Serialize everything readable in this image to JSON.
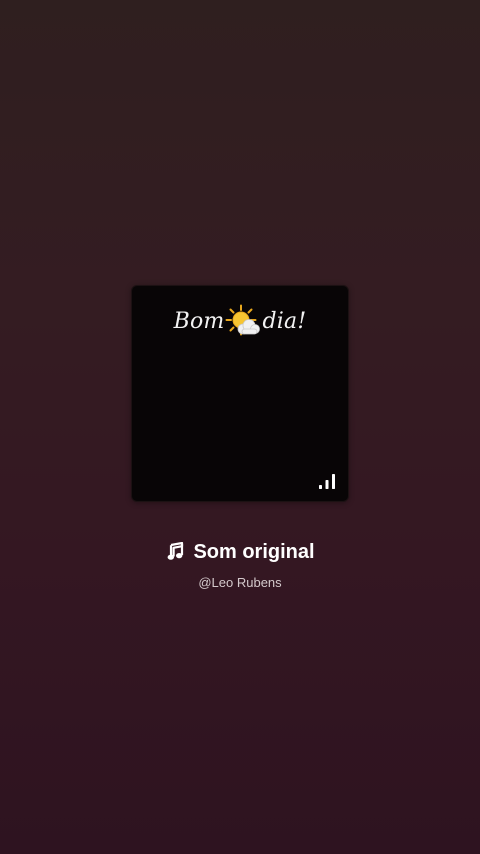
{
  "cover": {
    "caption_left": "Bom",
    "caption_right": "dia!",
    "caption_icon": "sun-behind-cloud-icon",
    "corner_icon": "signal-bars-icon"
  },
  "track": {
    "icon": "music-note-icon",
    "title": "Som original",
    "artist": "@Leo Rubens"
  },
  "colors": {
    "background_top": "#2f1f1f",
    "background_bottom": "#2e1320",
    "cover_background": "#080506",
    "title_text": "#ffffff",
    "artist_text": "#d4c9cc"
  }
}
